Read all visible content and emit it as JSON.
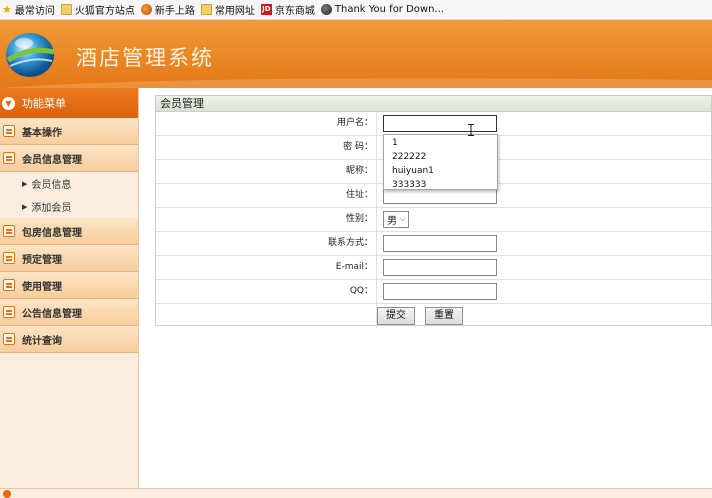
{
  "bookmarks": [
    {
      "icon": "star-icon",
      "label": "最常访问"
    },
    {
      "icon": "folder-icon",
      "label": "火狐官方站点"
    },
    {
      "icon": "firefox-icon",
      "label": "新手上路"
    },
    {
      "icon": "folder-icon",
      "label": "常用网址"
    },
    {
      "icon": "jd-icon",
      "label": "京东商城",
      "badge": "JD"
    },
    {
      "icon": "globe-icon",
      "label": "Thank You for Down..."
    }
  ],
  "header": {
    "title": "酒店管理系统"
  },
  "sidebar": {
    "menu_title": "功能菜单",
    "items": [
      {
        "label": "基本操作"
      },
      {
        "label": "会员信息管理"
      },
      {
        "label": "包房信息管理"
      },
      {
        "label": "预定管理"
      },
      {
        "label": "使用管理"
      },
      {
        "label": "公告信息管理"
      },
      {
        "label": "统计查询"
      }
    ],
    "subitems": [
      {
        "label": "会员信息"
      },
      {
        "label": "添加会员"
      }
    ]
  },
  "form": {
    "title": "会员管理",
    "fields": [
      {
        "label": "用户名：",
        "value": ""
      },
      {
        "label": "密  码：",
        "value": ""
      },
      {
        "label": "昵称：",
        "value": ""
      },
      {
        "label": "住址：",
        "value": ""
      },
      {
        "label": "性别：",
        "value": "男"
      },
      {
        "label": "联系方式：",
        "value": ""
      },
      {
        "label": "E-mail：",
        "value": ""
      },
      {
        "label": "QQ：",
        "value": ""
      }
    ],
    "submit_label": "提交",
    "reset_label": "重置"
  },
  "autocomplete": {
    "options": [
      "1",
      "222222",
      "huiyuan1",
      "333333"
    ]
  },
  "colors": {
    "header_orange": "#e47817",
    "menu_header": "#d9620c",
    "sidebar_bg": "#fbeee0",
    "panel_title_bg": "#d9e4d4"
  }
}
